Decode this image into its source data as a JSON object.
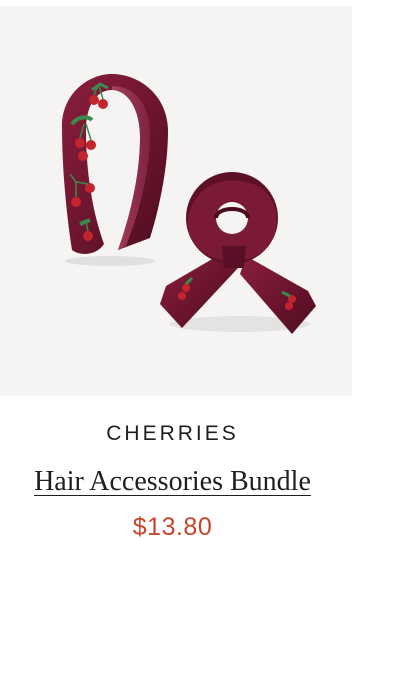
{
  "product": {
    "collection": "CHERRIES",
    "title": "Hair Accessories Bundle",
    "price": "$13.80",
    "image_subject": "velvet-headband-and-bow-scrunchie"
  },
  "colors": {
    "price": "#c8442a",
    "velvet": "#6e1530",
    "cherry": "#c4242e",
    "leaf": "#3b8a4e",
    "image_background": "#f5f4f3"
  }
}
